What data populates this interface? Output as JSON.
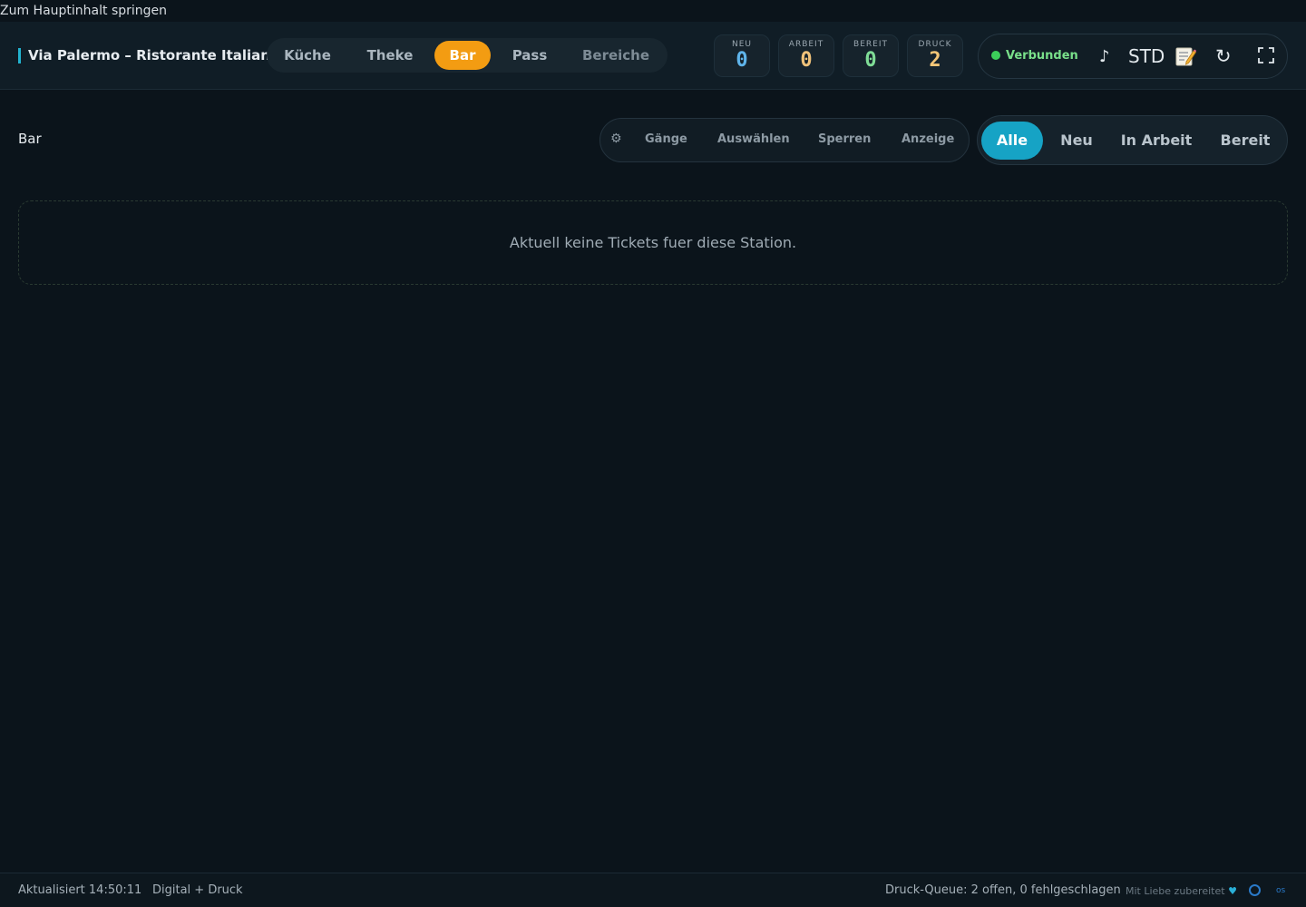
{
  "skip_link": "Zum Hauptinhalt springen",
  "header": {
    "brand": "Via Palermo – Ristorante Italiano",
    "stations": [
      {
        "label": "Küche",
        "active": false
      },
      {
        "label": "Theke",
        "active": false
      },
      {
        "label": "Bar",
        "active": true
      },
      {
        "label": "Pass",
        "active": false
      },
      {
        "label": "Bereiche",
        "active": false
      }
    ],
    "counters": [
      {
        "label": "NEU",
        "value": "0",
        "color": "#5fb4ea"
      },
      {
        "label": "ARBEIT",
        "value": "0",
        "color": "#f0c27a"
      },
      {
        "label": "BEREIT",
        "value": "0",
        "color": "#7fdc96"
      },
      {
        "label": "DRUCK",
        "value": "2",
        "color": "#f4c677"
      }
    ],
    "status": {
      "connection": "Verbunden",
      "sound_icon": "music-note-icon",
      "mode": "STD",
      "notes_icon": "memo-icon",
      "refresh_icon": "refresh-icon",
      "fullscreen_icon": "fullscreen-icon"
    }
  },
  "toolbar": {
    "title": "Bar",
    "settings_icon": "gear-icon",
    "tools": [
      "Gänge",
      "Auswählen",
      "Sperren",
      "Anzeige"
    ],
    "filters": [
      {
        "label": "Alle",
        "active": true
      },
      {
        "label": "Neu",
        "active": false
      },
      {
        "label": "In Arbeit",
        "active": false
      },
      {
        "label": "Bereit",
        "active": false
      }
    ]
  },
  "empty_message": "Aktuell keine Tickets fuer diese Station.",
  "footer": {
    "updated": "Aktualisiert 14:50:11",
    "mode": "Digital + Druck",
    "queue": "Druck-Queue: 2 offen, 0 fehlgeschlagen",
    "credit": "Mit Liebe zubereitet",
    "heart": "♥",
    "os_label": "os"
  },
  "colors": {
    "accent_orange": "#f39c12",
    "accent_cyan": "#16a3c5",
    "connected_green": "#3ccf5a"
  }
}
